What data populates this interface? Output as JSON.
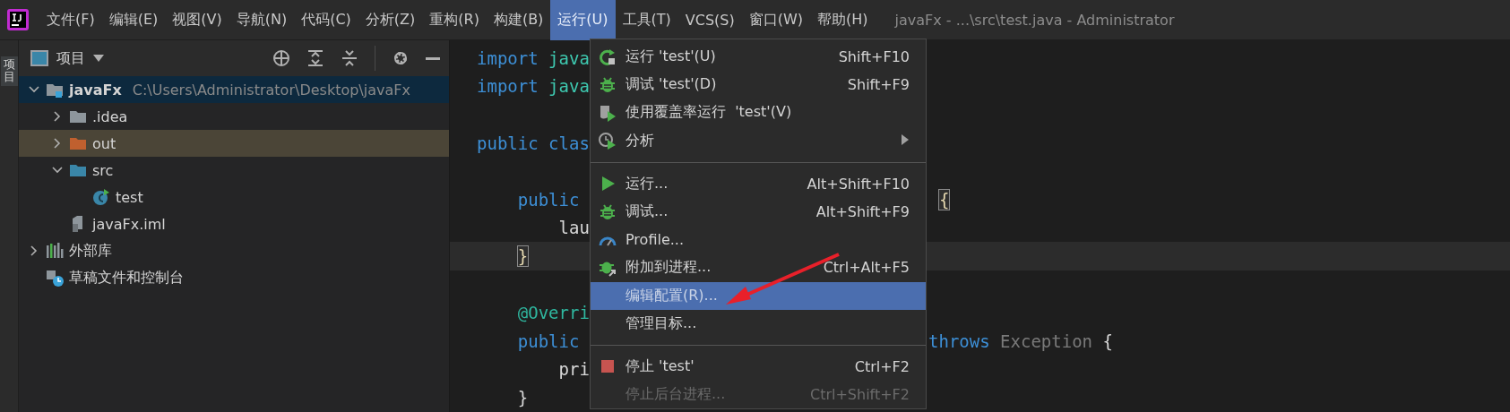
{
  "menu_bar": {
    "items": [
      {
        "label": "文件(F)",
        "selected": false
      },
      {
        "label": "编辑(E)",
        "selected": false
      },
      {
        "label": "视图(V)",
        "selected": false
      },
      {
        "label": "导航(N)",
        "selected": false
      },
      {
        "label": "代码(C)",
        "selected": false
      },
      {
        "label": "分析(Z)",
        "selected": false
      },
      {
        "label": "重构(R)",
        "selected": false
      },
      {
        "label": "构建(B)",
        "selected": false
      },
      {
        "label": "运行(U)",
        "selected": true
      },
      {
        "label": "工具(T)",
        "selected": false
      },
      {
        "label": "VCS(S)",
        "selected": false
      },
      {
        "label": "窗口(W)",
        "selected": false
      },
      {
        "label": "帮助(H)",
        "selected": false
      }
    ],
    "title": "javaFx - ...\\src\\test.java - Administrator"
  },
  "side_tab": {
    "label": "项目"
  },
  "project_panel": {
    "title": "项目",
    "tree": [
      {
        "name": "javaFx",
        "kind": "module",
        "path": "C:\\Users\\Administrator\\Desktop\\javaFx",
        "expanded": true,
        "selected": true,
        "highlighted": false,
        "children": [
          {
            "name": ".idea",
            "kind": "folder",
            "expanded": false,
            "selected": false,
            "highlighted": false
          },
          {
            "name": "out",
            "kind": "excluded_folder",
            "expanded": false,
            "selected": false,
            "highlighted": true
          },
          {
            "name": "src",
            "kind": "source_folder",
            "expanded": true,
            "selected": false,
            "highlighted": false,
            "children": [
              {
                "name": "test",
                "kind": "class",
                "selected": false,
                "highlighted": false
              }
            ]
          },
          {
            "name": "javaFx.iml",
            "kind": "file",
            "selected": false,
            "highlighted": false
          }
        ]
      },
      {
        "name": "外部库",
        "kind": "library",
        "expanded": false,
        "selected": false,
        "highlighted": false
      },
      {
        "name": "草稿文件和控制台",
        "kind": "scratches",
        "selected": false,
        "highlighted": false
      }
    ]
  },
  "editor": {
    "lines": [
      {
        "kind": "code",
        "current": false,
        "left": [
          {
            "text": "import",
            "kind": "keyword"
          },
          {
            "text": " java",
            "kind": "package"
          }
        ]
      },
      {
        "kind": "code",
        "current": false,
        "left": [
          {
            "text": "import",
            "kind": "keyword"
          },
          {
            "text": " java",
            "kind": "package"
          }
        ]
      },
      {
        "kind": "blank"
      },
      {
        "kind": "code",
        "current": false,
        "left": [
          {
            "text": "public clas",
            "kind": "keyword"
          }
        ]
      },
      {
        "kind": "blank"
      },
      {
        "kind": "code",
        "current": false,
        "left": [
          {
            "text": "    public",
            "kind": "keyword"
          }
        ],
        "right": [
          {
            "text": "{",
            "kind": "brace",
            "matched": true
          }
        ]
      },
      {
        "kind": "code",
        "current": false,
        "left": [
          {
            "text": "        lau",
            "kind": "plain"
          }
        ]
      },
      {
        "kind": "code",
        "current": true,
        "left": [
          {
            "text": "    }",
            "kind": "brace",
            "matched": true
          }
        ]
      },
      {
        "kind": "blank"
      },
      {
        "kind": "code",
        "current": false,
        "left": [
          {
            "text": "    @Overri",
            "kind": "annotation"
          }
        ]
      },
      {
        "kind": "code",
        "current": false,
        "left": [
          {
            "text": "    public",
            "kind": "keyword"
          }
        ],
        "right": [
          {
            "text": "throws",
            "kind": "keyword"
          },
          {
            "text": " Exception",
            "kind": "type"
          },
          {
            "text": " {",
            "kind": "plain"
          }
        ]
      },
      {
        "kind": "code",
        "current": false,
        "left": [
          {
            "text": "        pri",
            "kind": "plain"
          }
        ]
      },
      {
        "kind": "code",
        "current": false,
        "left": [
          {
            "text": "    }",
            "kind": "plain"
          }
        ]
      }
    ]
  },
  "run_menu": {
    "items": [
      {
        "kind": "rerun",
        "label": "运行 'test'(U)",
        "shortcut": "Shift+F10",
        "selected": false,
        "disabled": false
      },
      {
        "kind": "debug",
        "label": "调试 'test'(D)",
        "shortcut": "Shift+F9",
        "selected": false,
        "disabled": false
      },
      {
        "kind": "coverage",
        "label": "使用覆盖率运行  'test'(V)",
        "selected": false,
        "disabled": false
      },
      {
        "kind": "analyze",
        "label": "分析",
        "selected": false,
        "disabled": false
      },
      {
        "kind": "separator"
      },
      {
        "kind": "run",
        "label": "运行...",
        "shortcut": "Alt+Shift+F10",
        "selected": false,
        "disabled": false
      },
      {
        "kind": "debug",
        "label": "调试...",
        "shortcut": "Alt+Shift+F9",
        "selected": false,
        "disabled": false
      },
      {
        "kind": "profile",
        "label": "Profile...",
        "selected": false,
        "disabled": false
      },
      {
        "kind": "attach",
        "label": "附加到进程...",
        "shortcut": "Ctrl+Alt+F5",
        "selected": false,
        "disabled": false
      },
      {
        "kind": "plain",
        "label": "编辑配置(R)...",
        "selected": true,
        "disabled": false
      },
      {
        "kind": "plain",
        "label": "管理目标...",
        "selected": false,
        "disabled": false
      },
      {
        "kind": "separator"
      },
      {
        "kind": "stop",
        "label": "停止 'test'",
        "shortcut": "Ctrl+F2",
        "selected": false,
        "disabled": false
      },
      {
        "kind": "plain",
        "label": "停止后台进程...",
        "shortcut": "Ctrl+Shift+F2",
        "selected": false,
        "disabled": true
      }
    ]
  }
}
